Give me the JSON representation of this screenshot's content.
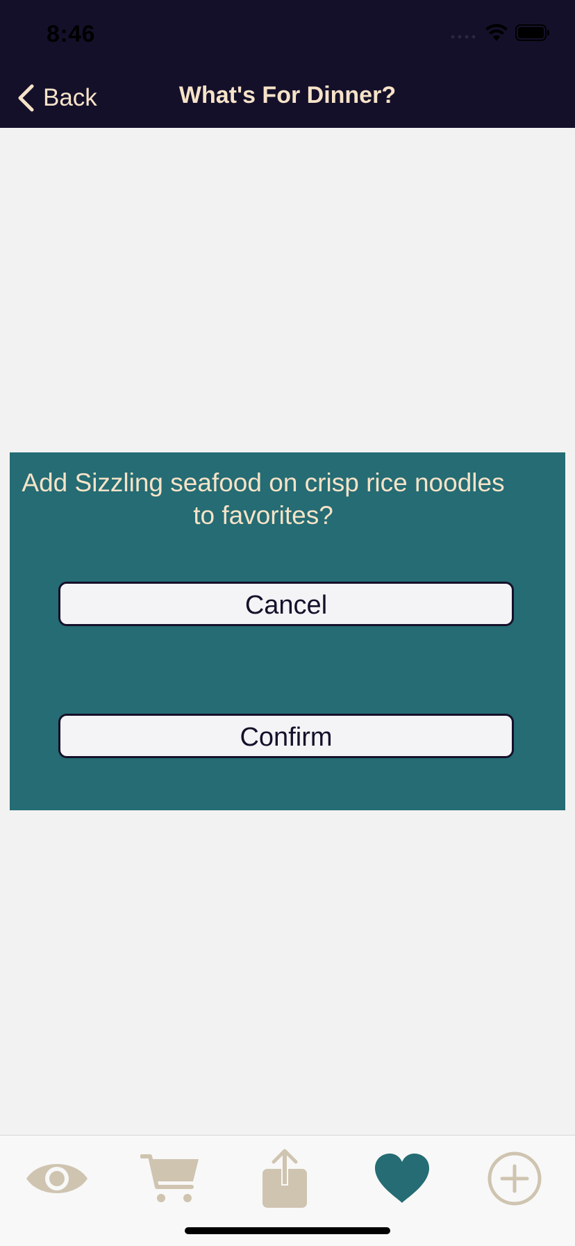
{
  "status_bar": {
    "time": "8:46"
  },
  "nav": {
    "back_label": "Back",
    "title": "What's For Dinner?"
  },
  "dialog": {
    "message": "Add Sizzling seafood on crisp rice noodles to favorites?",
    "cancel_label": "Cancel",
    "confirm_label": "Confirm"
  },
  "tab_bar": {
    "items": [
      {
        "icon": "eye-icon",
        "selected": false
      },
      {
        "icon": "cart-icon",
        "selected": false
      },
      {
        "icon": "share-icon",
        "selected": false
      },
      {
        "icon": "heart-icon",
        "selected": true
      },
      {
        "icon": "plus-circle-icon",
        "selected": false
      }
    ]
  },
  "colors": {
    "header_bg": "#15102a",
    "accent_text": "#f6e3c8",
    "dialog_bg": "#256c74",
    "tab_icon": "#cfc4b0",
    "tab_icon_selected": "#256c74",
    "page_bg": "#f2f2f2"
  }
}
